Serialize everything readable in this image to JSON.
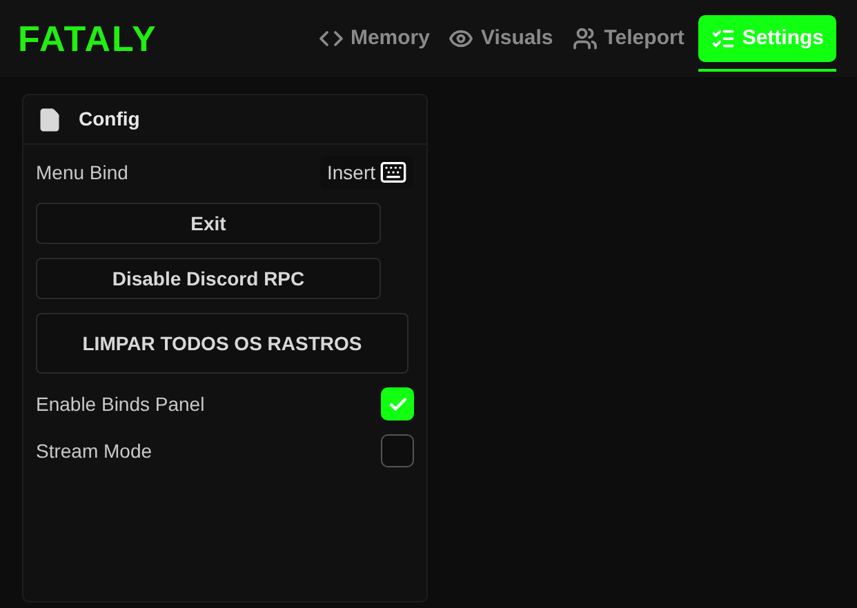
{
  "brand": "FATALY",
  "tabs": [
    {
      "label": "Memory",
      "selected": false
    },
    {
      "label": "Visuals",
      "selected": false
    },
    {
      "label": "Teleport",
      "selected": false
    },
    {
      "label": "Settings",
      "selected": true
    }
  ],
  "panel": {
    "title": "Config",
    "items": [
      {
        "kind": "keybind",
        "label": "Menu Bind",
        "value": "Insert"
      },
      {
        "kind": "button",
        "label": "Exit"
      },
      {
        "kind": "button",
        "label": "Disable Discord RPC"
      },
      {
        "kind": "large-button",
        "label": "LIMPAR TODOS OS RASTROS"
      },
      {
        "kind": "checkbox",
        "label": "Enable Binds Panel",
        "checked": true
      },
      {
        "kind": "checkbox",
        "label": "Stream Mode",
        "checked": false
      }
    ]
  }
}
